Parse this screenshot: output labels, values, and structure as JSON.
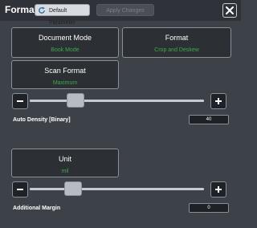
{
  "header": {
    "title": "Format",
    "default_label": "Default Parameter",
    "apply_label": "Apply Changes"
  },
  "cards": {
    "document_mode": {
      "label": "Document Mode",
      "value": "Book Mode"
    },
    "format": {
      "label": "Format",
      "value": "Crop and Deskew"
    },
    "scan_format": {
      "label": "Scan Format",
      "value": "Maximum"
    },
    "unit": {
      "label": "Unit",
      "value": "mil"
    }
  },
  "auto_density": {
    "label": "Auto Density [Binary]",
    "value": "40"
  },
  "additional_margin": {
    "label": "Additional Margin",
    "value": "0"
  },
  "colors": {
    "background": "#3d4148",
    "card": "#2c2f34",
    "value_text": "#3ea84a"
  }
}
